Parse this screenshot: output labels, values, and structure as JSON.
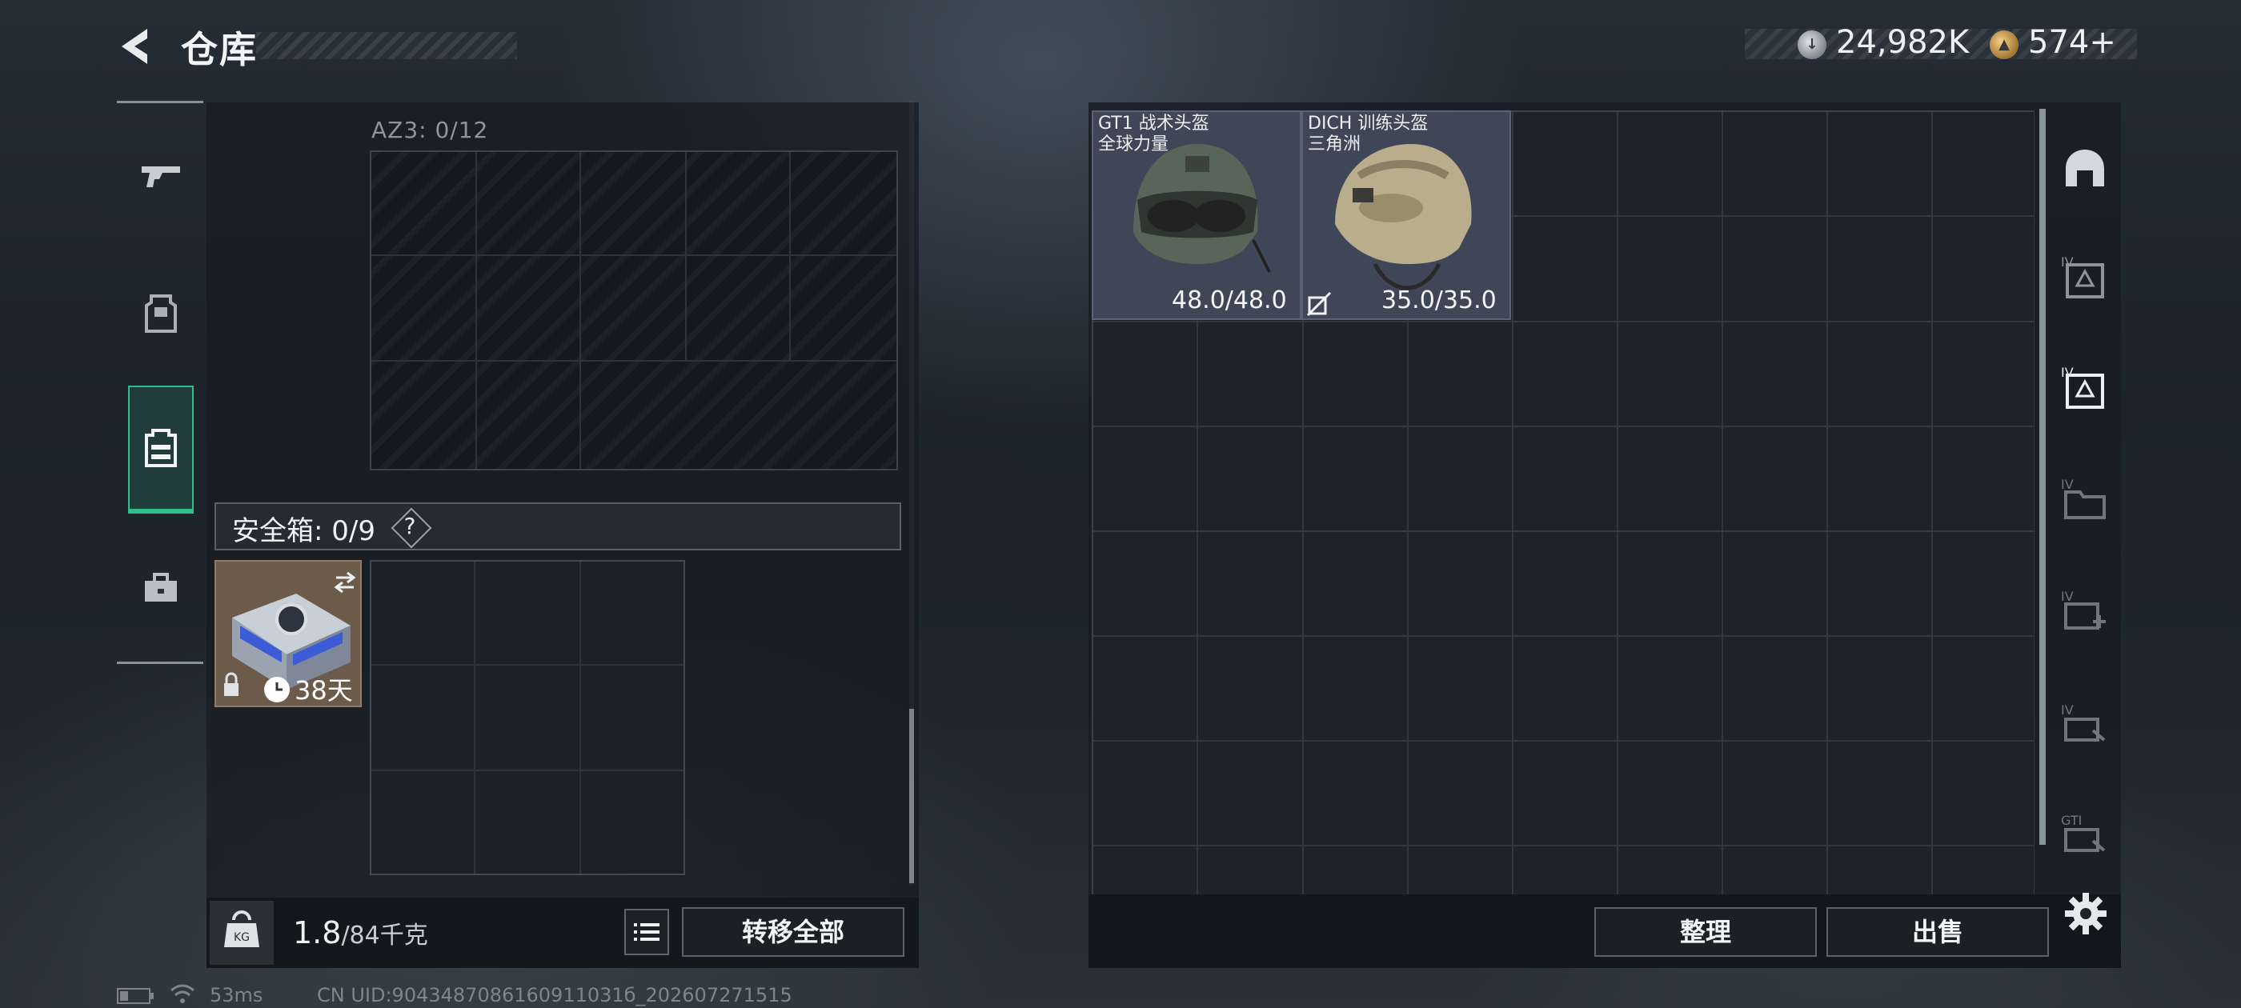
{
  "header": {
    "title": "仓库",
    "currency": [
      {
        "icon": "silver-coin-icon",
        "value": "24,982K",
        "color": "#c9ced2"
      },
      {
        "icon": "gold-coin-icon",
        "value": "574+",
        "color": "#d7a94f"
      }
    ]
  },
  "left_nav": [
    {
      "icon": "gun-icon",
      "active": false
    },
    {
      "icon": "armor-vest-icon",
      "active": false
    },
    {
      "icon": "backpack-icon",
      "active": true
    },
    {
      "icon": "toolbox-icon",
      "active": false
    }
  ],
  "left_panel": {
    "container_label": "AZ3: 0/12",
    "safe_box": {
      "label": "安全箱: 0/9",
      "help": "?",
      "item_days": "38天"
    },
    "weight": {
      "current": "1.8",
      "max": "/84千克"
    },
    "transfer_all_label": "转移全部"
  },
  "stash": {
    "items": [
      {
        "name": "GT1 战术头盔",
        "subtitle": "全球力量",
        "durability": "48.0/48.0"
      },
      {
        "name": "DICH 训练头盔",
        "subtitle": "三角洲",
        "durability": "35.0/35.0"
      }
    ],
    "categories": [
      "helmet-category-icon",
      "tier4-armor-icon",
      "tier4-armor-selected-icon",
      "tier4-folder-icon",
      "tier4-medkit-icon",
      "tier4-cards-icon",
      "gti-cards-icon"
    ]
  },
  "footer": {
    "sort_label": "整理",
    "sell_label": "出售"
  },
  "status": {
    "ping": "53ms",
    "uid": "CN UID:9043487086160911031б_202607271515"
  },
  "colors": {
    "accent": "#2fbf8a",
    "item_tile": "#3f4658"
  }
}
